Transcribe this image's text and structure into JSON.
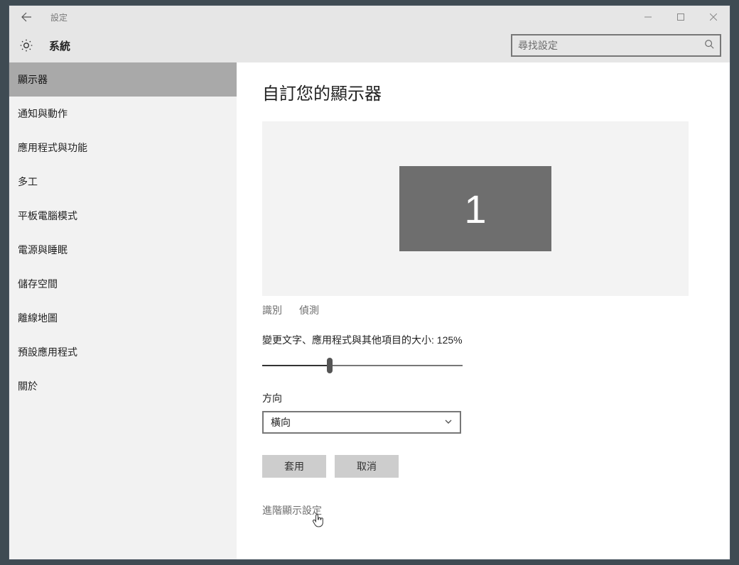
{
  "window": {
    "title": "設定",
    "section": "系統",
    "search_placeholder": "尋找設定"
  },
  "sidebar": {
    "items": [
      {
        "label": "顯示器",
        "selected": true
      },
      {
        "label": "通知與動作",
        "selected": false
      },
      {
        "label": "應用程式與功能",
        "selected": false
      },
      {
        "label": "多工",
        "selected": false
      },
      {
        "label": "平板電腦模式",
        "selected": false
      },
      {
        "label": "電源與睡眠",
        "selected": false
      },
      {
        "label": "儲存空間",
        "selected": false
      },
      {
        "label": "離線地圖",
        "selected": false
      },
      {
        "label": "預設應用程式",
        "selected": false
      },
      {
        "label": "關於",
        "selected": false
      }
    ]
  },
  "content": {
    "heading": "自訂您的顯示器",
    "display_number": "1",
    "identify_label": "識別",
    "detect_label": "偵測",
    "scale_label_prefix": "變更文字、應用程式與其他項目的大小: ",
    "scale_value": "125%",
    "orientation_label": "方向",
    "orientation_value": "橫向",
    "apply_label": "套用",
    "cancel_label": "取消",
    "advanced_label": "進階顯示設定"
  }
}
